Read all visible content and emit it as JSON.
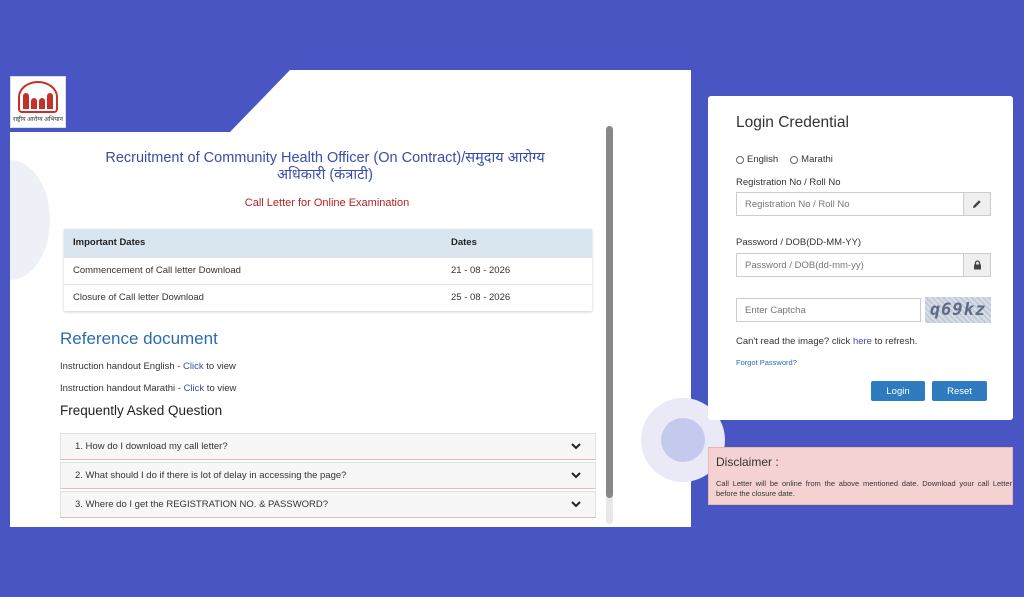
{
  "logo": {
    "text": "राष्ट्रीय आरोग्य अभियान"
  },
  "page": {
    "title": "Recruitment of Community Health Officer (On Contract)/समुदाय आरोग्य अधिकारी (कंत्राटी)",
    "subtitle": "Call Letter for Online Examination"
  },
  "dates_table": {
    "headers": [
      "Important Dates",
      "Dates"
    ],
    "rows": [
      {
        "label": "Commencement of Call letter Download",
        "date": "21 - 08 - 2026"
      },
      {
        "label": "Closure of Call letter Download",
        "date": "25 - 08 - 2026"
      }
    ]
  },
  "reference": {
    "title": "Reference document",
    "items": [
      {
        "prefix": "Instruction handout English - ",
        "link": "Click",
        "suffix": " to view"
      },
      {
        "prefix": "Instruction handout Marathi - ",
        "link": "Click",
        "suffix": " to view"
      }
    ]
  },
  "faq": {
    "title": "Frequently Asked Question",
    "items": [
      "1. How do I download my call letter?",
      "2. What should I do if there is lot of delay in accessing the page?",
      "3. Where do I get the REGISTRATION NO. & PASSWORD?"
    ]
  },
  "login": {
    "title": "Login Credential",
    "lang_options": [
      "English",
      "Marathi"
    ],
    "reg_label": "Registration No / Roll No",
    "reg_placeholder": "Registration No / Roll No",
    "pwd_label": "Password / DOB(DD-MM-YY)",
    "pwd_placeholder": "Password / DOB(dd-mm-yy)",
    "captcha_placeholder": "Enter Captcha",
    "captcha_text": "q69kz",
    "refresh_prefix": "Can't read the image? click ",
    "refresh_link": "here",
    "refresh_suffix": " to refresh.",
    "forgot": "Forgot Password?",
    "login_btn": "Login",
    "reset_btn": "Reset"
  },
  "disclaimer": {
    "title": "Disclaimer :",
    "text": "Call Letter will be online from the above mentioned date. Download your call Letter before the closure date."
  },
  "colors": {
    "background": "#4a55c4",
    "accent_blue": "#2f7bc0",
    "title_blue": "#3a4ca8",
    "subtitle_red": "#b02424",
    "disclaimer_bg": "#f5d2d2"
  },
  "icons": {
    "reg_addon": "pencil-icon",
    "pwd_addon": "lock-icon",
    "faq_toggle": "chevron-down-icon"
  }
}
